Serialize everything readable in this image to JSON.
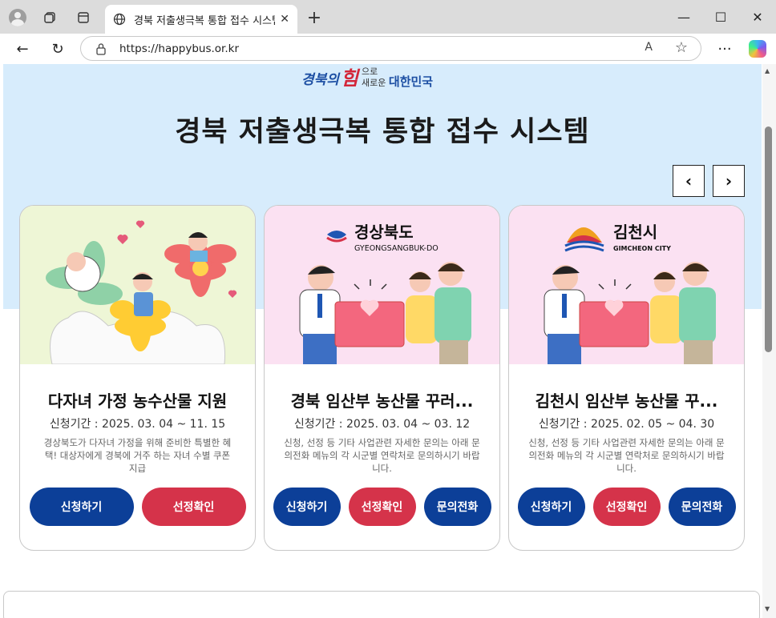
{
  "browser": {
    "tab_title": "경북 저출생극복 통합 접수 시스템",
    "tab_close": "✕",
    "new_tab": "+",
    "url": "https://happybus.or.kr",
    "window_controls": {
      "minimize": "—",
      "maximize": "☐",
      "close": "✕"
    },
    "toolbar": {
      "back": "←",
      "reload": "↻",
      "more": "···",
      "read_aloud": "A",
      "favorite": "☆"
    }
  },
  "logo": {
    "script": "경북의",
    "him": "힘",
    "line1": "으로",
    "line2": "새로운",
    "strong": "대한민국"
  },
  "header": {
    "title": "경북 저출생극복 통합 접수 시스템"
  },
  "carousel": {
    "prev": "‹",
    "next": "›"
  },
  "cards": [
    {
      "title": "다자녀 가정 농수산물 지원",
      "period": "신청기간 : 2025. 03. 04 ~ 11. 15",
      "desc": "경상북도가 다자녀 가정을 위해 준비한 특별한 혜택! 대상자에게 경북에 거주 하는 자녀 수별 쿠폰 지급",
      "buttons": [
        "신청하기",
        "선정확인"
      ]
    },
    {
      "title": "경북 임산부 농산물 꾸러...",
      "period": "신청기간 : 2025. 03. 04 ~ 03. 12",
      "desc": "신청, 선정 등 기타 사업관련 자세한 문의는 아래 문의전화 메뉴의 각 시군별 연락처로 문의하시기 바랍니다.",
      "buttons": [
        "신청하기",
        "선정확인",
        "문의전화"
      ],
      "logo_ko": "경상북도",
      "logo_en": "GYEONGSANGBUK-DO"
    },
    {
      "title": "김천시 임산부 농산물 꾸...",
      "period": "신청기간 : 2025. 02. 05 ~ 04. 30",
      "desc": "신청, 선정 등 기타 사업관련 자세한 문의는 아래 문의전화 메뉴의 각 시군별 연락처로 문의하시기 바랍니다.",
      "buttons": [
        "신청하기",
        "선정확인",
        "문의전화"
      ],
      "logo_ko": "김천시",
      "logo_en": "GIMCHEON CITY"
    }
  ],
  "colors": {
    "hero_bg": "#d7ecfc",
    "primary_blue": "#0c3f98",
    "primary_red": "#d5334a",
    "card1_bg": "#eef6d6",
    "card2_bg": "#fbe1f2"
  }
}
